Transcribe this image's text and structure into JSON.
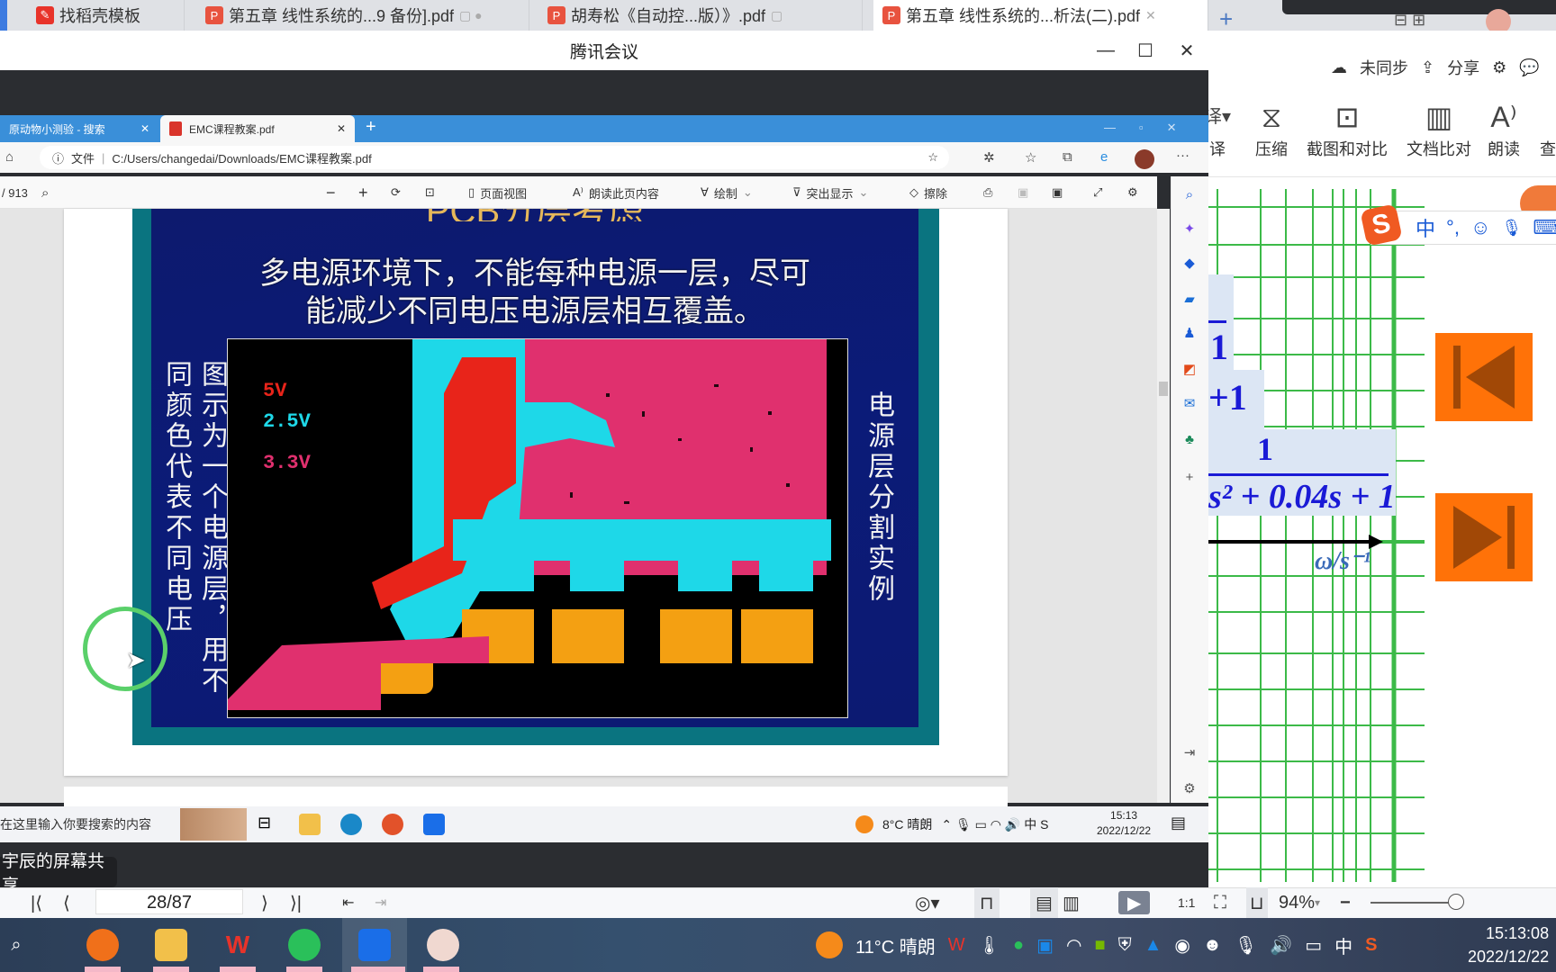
{
  "wps": {
    "tabs": [
      {
        "label": "找稻壳模板",
        "icon": "docer-icon"
      },
      {
        "label": "第五章 线性系统的...9 备份].pdf",
        "icon": "pdf-icon"
      },
      {
        "label": "胡寿松《自动控...版）》.pdf",
        "icon": "pdf-icon"
      },
      {
        "label": "第五章 线性系统的...析法(二).pdf",
        "icon": "pdf-icon",
        "active": true
      }
    ],
    "new_tab": "+",
    "sync_status": "未同步",
    "share_label": "分享",
    "toolbar": [
      {
        "label": "译",
        "glyph": "译▾"
      },
      {
        "label": "压缩",
        "glyph": "⧖"
      },
      {
        "label": "截图和对比",
        "glyph": "⊡"
      },
      {
        "label": "文档比对",
        "glyph": "▥"
      },
      {
        "label": "朗读",
        "glyph": "A⁾"
      },
      {
        "label": "查",
        "glyph": ""
      }
    ],
    "equation": {
      "frac1_den": "1",
      "frac2_den": "+1",
      "frac3_num": "1",
      "frac3_den": "s² + 0.04s + 1"
    },
    "axis_label": "ω/s⁻¹",
    "ime": {
      "lang": "中",
      "punct": "°,",
      "emoji": "☺",
      "mic": "🎙",
      "keyboard": "⌨"
    },
    "status": {
      "page": "28/87",
      "zoom": "94%"
    },
    "colors": {
      "nav_button": "#ff7208",
      "grid": "#3cba48",
      "equation": "#1a1ad6"
    }
  },
  "meeting": {
    "title": "腾讯会议",
    "share_label": "宇辰的屏幕共享"
  },
  "edge": {
    "tabs": [
      {
        "label": "原动物小测验 - 搜索"
      },
      {
        "label": "EMC课程教案.pdf",
        "active": true
      }
    ],
    "address": {
      "scheme_label": "文件",
      "url": "C:/Users/changedai/Downloads/EMC课程教案.pdf"
    },
    "pdf_toolbar": {
      "page_count": "/ 913",
      "page_view": "页面视图",
      "read_aloud": "朗读此页内容",
      "draw": "绘制",
      "highlight": "突出显示",
      "erase": "擦除"
    },
    "slide": {
      "title": "PCB分层考虑",
      "line1": "多电源环境下，不能每种电源一层，尽可",
      "line2": "能减少不同电压电源层相互覆盖。",
      "left_col1": "图示为一个电源层，用不",
      "left_col2": "同颜色代表不同电压",
      "right_col": "电源层分割实例",
      "legend": [
        {
          "label": "5V",
          "color": "#e8241a"
        },
        {
          "label": "2.5V",
          "color": "#1ed8e8"
        },
        {
          "label": "3.3V",
          "color": "#e0306e"
        }
      ]
    },
    "inner_taskbar": {
      "search_placeholder": "在这里输入你要搜索的内容",
      "weather": "8°C  晴朗",
      "time": "15:13",
      "date": "2022/12/22"
    }
  },
  "taskbar": {
    "weather": "11°C  晴朗",
    "ime": "中",
    "time": "15:13:08",
    "date": "2022/12/22"
  }
}
